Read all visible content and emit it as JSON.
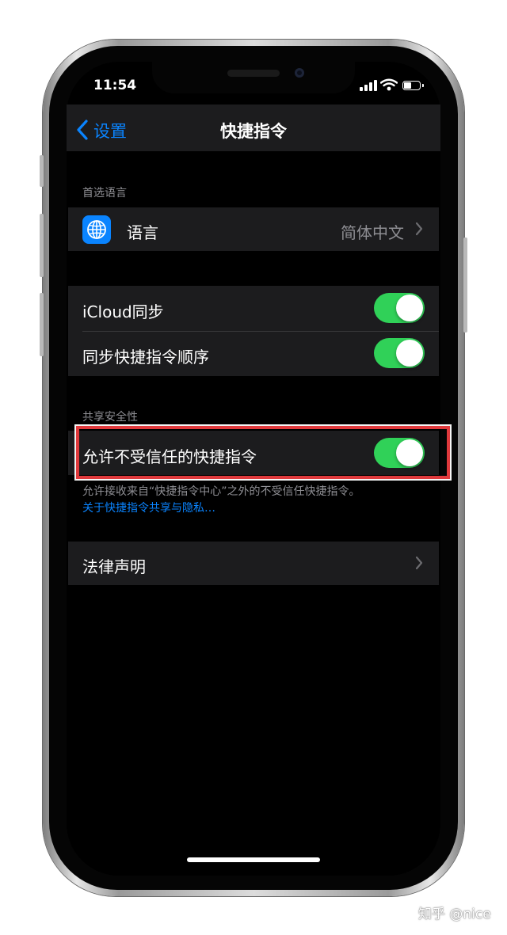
{
  "status_bar": {
    "time": "11:54"
  },
  "nav": {
    "back_label": "设置",
    "title": "快捷指令"
  },
  "language_section": {
    "header": "首选语言",
    "language_label": "语言",
    "language_value": "简体中文"
  },
  "sync_section": {
    "icloud_sync_label": "iCloud同步",
    "icloud_sync_on": true,
    "sync_order_label": "同步快捷指令顺序",
    "sync_order_on": true
  },
  "sharing_section": {
    "header": "共享安全性",
    "untrusted_label": "允许不受信任的快捷指令",
    "untrusted_on": true,
    "footer_text": "允许接收来自“快捷指令中心”之外的不受信任快捷指令。",
    "footer_link": "关于快捷指令共享与隐私…"
  },
  "legal_section": {
    "label": "法律声明"
  },
  "colors": {
    "accent": "#0a84ff",
    "toggle_on": "#30d158",
    "highlight": "#e0393c"
  },
  "watermark": "知乎 @nice"
}
